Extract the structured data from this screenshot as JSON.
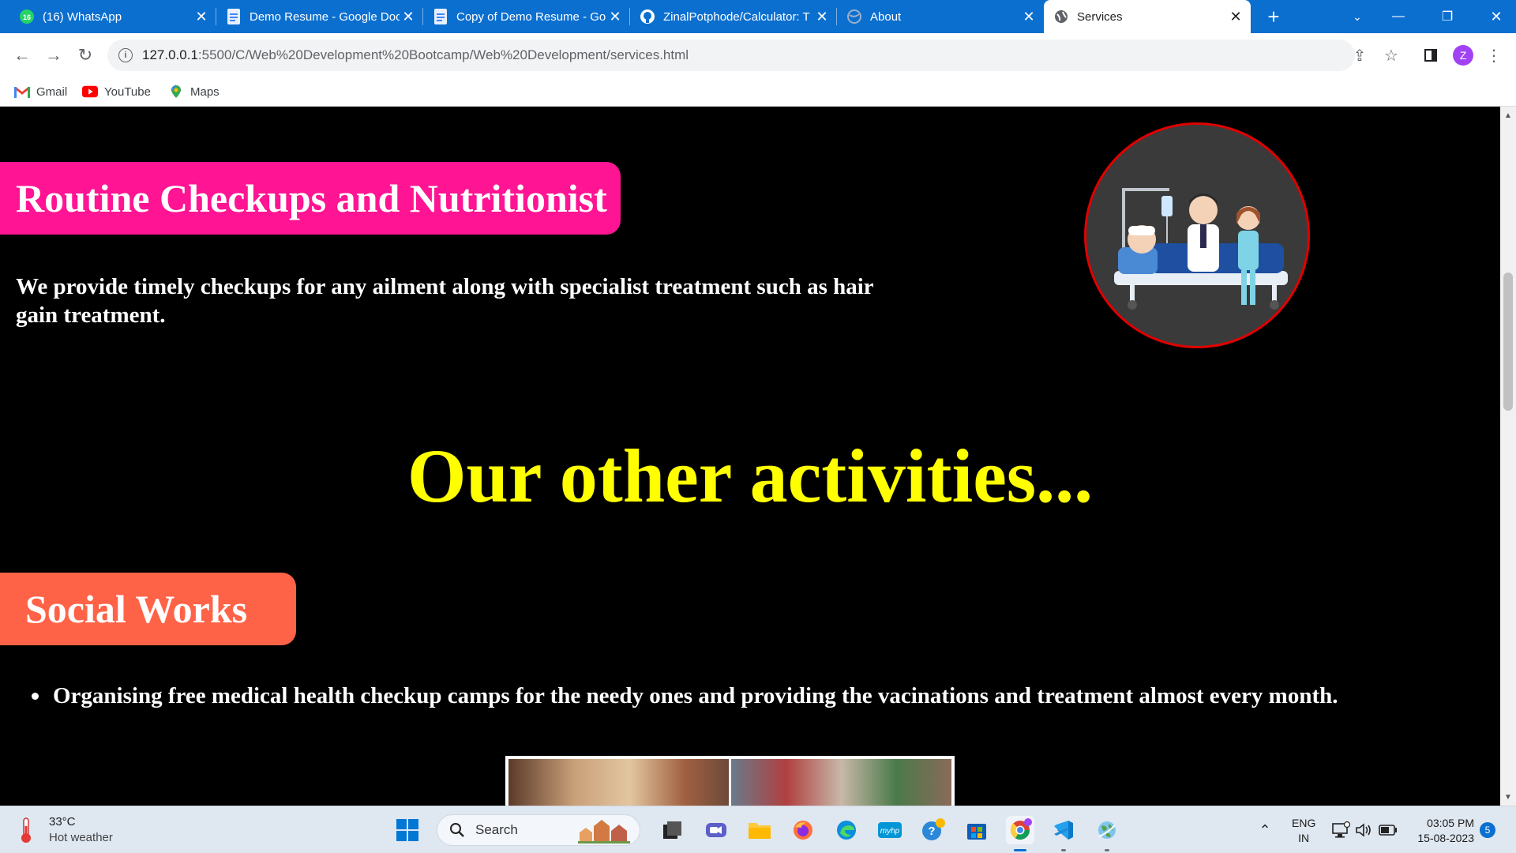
{
  "browser": {
    "tabs": [
      {
        "title": "(16) WhatsApp",
        "icon": "whatsapp-icon"
      },
      {
        "title": "Demo Resume - Google Docs",
        "icon": "google-docs-icon"
      },
      {
        "title": "Copy of Demo Resume - Google Docs",
        "icon": "google-docs-icon"
      },
      {
        "title": "ZinalPotphode/Calculator: T",
        "icon": "github-icon"
      },
      {
        "title": "About",
        "icon": "globe-icon"
      },
      {
        "title": "Services",
        "icon": "globe-icon",
        "active": true
      }
    ],
    "whatsapp_badge": "16",
    "url_host": "127.0.0.1",
    "url_path": ":5500/C/Web%20Development%20Bootcamp/Web%20Development/services.html",
    "profile_initial": "Z",
    "bookmarks": [
      {
        "label": "Gmail",
        "icon": "gmail-icon"
      },
      {
        "label": "YouTube",
        "icon": "youtube-icon"
      },
      {
        "label": "Maps",
        "icon": "maps-icon"
      }
    ]
  },
  "page": {
    "section1_title": "Routine Checkups and Nutritionist",
    "section1_text": "We provide timely checkups for any ailment along with specialist treatment such as hair gain treatment.",
    "activities_heading": "Our other activities...",
    "section2_title": "Social Works",
    "section2_bullet": "Organising free medical health checkup camps for the needy ones and providing the vacinations and treatment almost every month.",
    "colors": {
      "pink_banner": "#ff1493",
      "coral_banner": "#ff6347",
      "heading": "#ffff00",
      "circle_border": "#e00000"
    }
  },
  "taskbar": {
    "weather_temp": "33°C",
    "weather_desc": "Hot weather",
    "search_label": "Search",
    "lang_line1": "ENG",
    "lang_line2": "IN",
    "time": "03:05 PM",
    "date": "15-08-2023",
    "notification_count": "5"
  }
}
